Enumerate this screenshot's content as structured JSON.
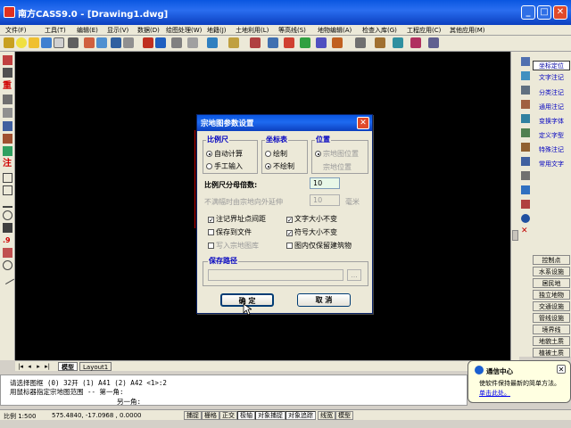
{
  "window": {
    "title": "南方CASS9.0 - [Drawing1.dwg]"
  },
  "menu": [
    "文件(F)",
    "工具(T)",
    "编辑(E)",
    "显示(V)",
    "数据(D)",
    "绘图处理(W)",
    "地籍(J)",
    "土地利用(L)",
    "等高线(S)",
    "地物编辑(A)",
    "检查入库(G)",
    "工程应用(C)",
    "其他应用(M)"
  ],
  "dialog": {
    "title": "宗地图参数设置",
    "scale": {
      "title": "比例尺",
      "auto": "自动计算",
      "manual": "手工输入"
    },
    "grid": {
      "title": "坐标表",
      "draw": "绘制",
      "nodraw": "不绘制"
    },
    "position": {
      "title": "位置",
      "inmap": "宗地图位置",
      "parcel": "宗地位置"
    },
    "denominator_label": "比例尺分母倍数:",
    "denominator_value": "10",
    "extend_label": "不满幅时由宗地向外延伸",
    "extend_value": "10",
    "extend_unit": "毫米",
    "opts": {
      "note_points": "注记界址点间距",
      "text_fixed": "文字大小不变",
      "save_file": "保存到文件",
      "symbol_fixed": "符号大小不变",
      "write_db": "写入宗地图库",
      "keep_buildings": "图内仅保留建筑物"
    },
    "save_path_title": "保存路径",
    "browse": "...",
    "ok": "确 定",
    "cancel": "取 消"
  },
  "right_panel": {
    "items": [
      "坐标定位",
      "文字注记",
      "分类注记",
      "通用注记",
      "变换字体",
      "定义字型",
      "特殊注记",
      "常用文字"
    ],
    "buttons": [
      "控制点",
      "水系设施",
      "居民地",
      "独立地物",
      "交通设施",
      "管线设施",
      "境界线",
      "地貌土质",
      "植被土质"
    ]
  },
  "tabs": [
    "模型",
    "Layout1"
  ],
  "command": {
    "line1": "请选择图框 (0) 32开 (1) A41 (2) A42 <1>:2",
    "line2": "用鼠标器指定宗地图范围 -- 第一角:",
    "line3": "另一角:"
  },
  "status": {
    "scale": "比例 1:500",
    "coords": "575.4840, -17.0968 , 0.0000",
    "buttons": [
      "捕捉",
      "栅格",
      "正交",
      "极轴",
      "对象捕捉",
      "对象追踪",
      "线宽",
      "模型"
    ]
  },
  "balloon": {
    "title": "通信中心",
    "message": "使软件保持最新的简单方法。",
    "link": "单击此处。"
  },
  "colors": {
    "titlebar": "#0a56e0",
    "link": "#0000c0"
  }
}
